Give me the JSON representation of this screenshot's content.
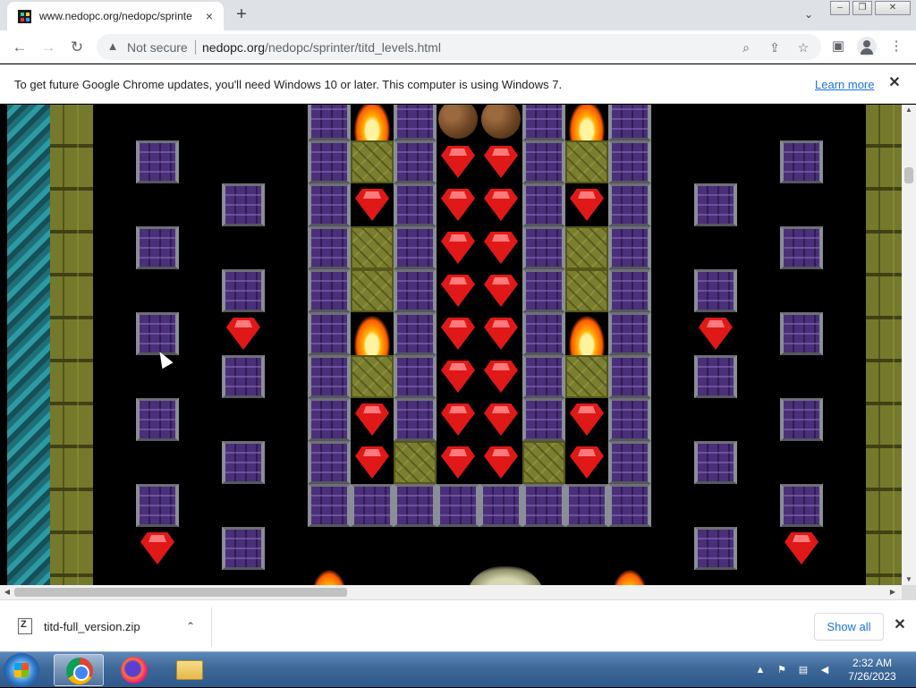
{
  "browser": {
    "tab_title": "www.nedopc.org/nedopc/sprinte",
    "tab_close_icon": "×",
    "new_tab_icon": "+",
    "url_security": "Not secure",
    "url_host": "nedopc.org",
    "url_path": "/nedopc/sprinter/titd_levels.html"
  },
  "infobar": {
    "message": "To get future Google Chrome updates, you'll need Windows 10 or later. This computer is using Windows 7.",
    "learn_more": "Learn more"
  },
  "downloads": {
    "file_name": "titd-full_version.zip",
    "show_all": "Show all"
  },
  "taskbar": {
    "time": "2:32 AM",
    "date": "7/26/2023"
  },
  "game": {
    "tiles": [
      "pillar",
      "block",
      "gem",
      "fire",
      "boulder",
      "skull"
    ]
  }
}
